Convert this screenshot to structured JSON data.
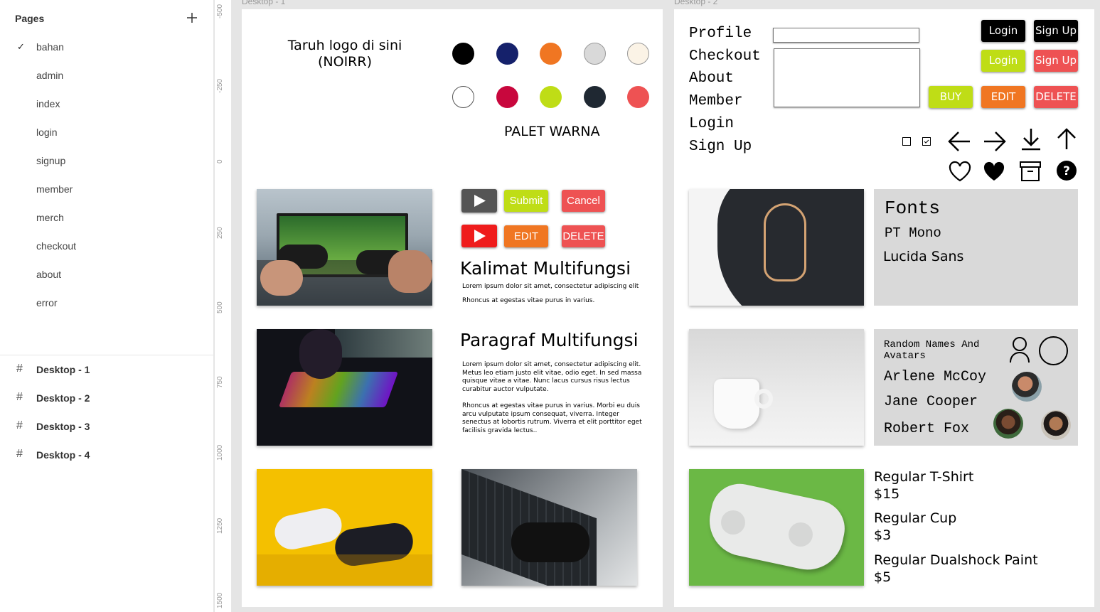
{
  "sidebar": {
    "pages_title": "Pages",
    "add_icon": "plus-icon",
    "pages": [
      {
        "label": "bahan",
        "selected": true
      },
      {
        "label": "admin"
      },
      {
        "label": "index"
      },
      {
        "label": "login"
      },
      {
        "label": "signup"
      },
      {
        "label": "member"
      },
      {
        "label": "merch"
      },
      {
        "label": "checkout"
      },
      {
        "label": "about"
      },
      {
        "label": "error"
      }
    ],
    "frames": [
      {
        "label": "Desktop - 1"
      },
      {
        "label": "Desktop - 2"
      },
      {
        "label": "Desktop - 3"
      },
      {
        "label": "Desktop - 4"
      }
    ]
  },
  "ruler": {
    "ticks": [
      "-500",
      "-250",
      "0",
      "250",
      "500",
      "750",
      "1000",
      "1250",
      "1500"
    ]
  },
  "frame1": {
    "label": "Desktop - 1",
    "logo_text": "Taruh logo di sini\n(NOIRR)",
    "palette_title": "PALET WARNA",
    "palette": [
      "#000000",
      "#15216b",
      "#f07622",
      "#d9d9d9",
      "#fbf3e6",
      "#ffffff",
      "#c8073d",
      "#bfdd16",
      "#1f2832",
      "#ee5253"
    ],
    "buttons": {
      "submit": "Submit",
      "cancel": "Cancel",
      "edit": "EDIT",
      "delete": "DELETE"
    },
    "kalimat_title": "Kalimat Multifungsi",
    "kalimat_line1": "Lorem ipsum dolor sit amet, consectetur adipiscing elit",
    "kalimat_line2": "Rhoncus at egestas vitae purus in varius.",
    "paragraf_title": "Paragraf Multifungsi",
    "paragraf_p1": "Lorem ipsum dolor sit amet, consectetur adipiscing elit. Metus leo etiam justo elit vitae, odio eget. In sed massa quisque vitae a vitae. Nunc lacus cursus risus lectus curabitur auctor vulputate.",
    "paragraf_p2": "Rhoncus at egestas vitae purus in varius. Morbi eu duis arcu vulputate ipsum consequat, viverra. Integer senectus at lobortis rutrum. Viverra et elit porttitor eget facilisis gravida lectus.."
  },
  "frame2": {
    "label": "Desktop - 2",
    "nav": [
      "Profile",
      "Checkout",
      "About",
      "Member",
      "Login",
      "Sign Up"
    ],
    "buttons": {
      "login": "Login",
      "signup": "Sign Up",
      "buy": "BUY",
      "edit": "EDIT",
      "delete": "DELETE"
    },
    "fonts_title": "Fonts",
    "font1": "PT Mono",
    "font2": "Lucida Sans",
    "names_title": "Random Names And Avatars",
    "names": [
      "Arlene McCoy",
      "Jane Cooper",
      "Robert Fox"
    ],
    "products": [
      {
        "name": "Regular T-Shirt",
        "price": "$15"
      },
      {
        "name": "Regular Cup",
        "price": "$3"
      },
      {
        "name": "Regular Dualshock Paint",
        "price": "$5"
      }
    ]
  }
}
